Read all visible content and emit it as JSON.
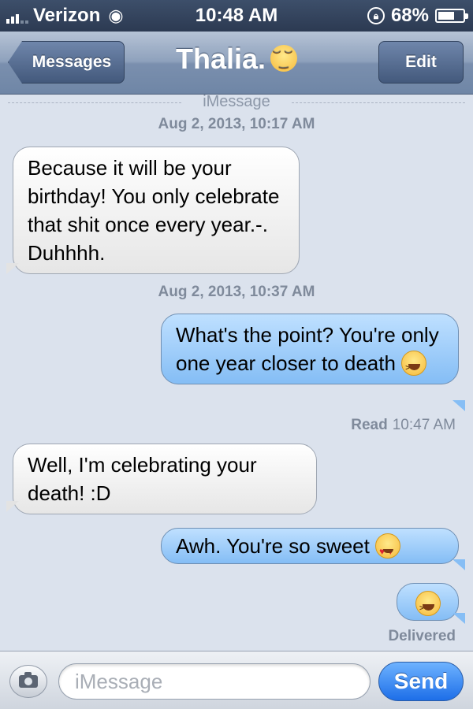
{
  "status_bar": {
    "carrier": "Verizon",
    "time": "10:48 AM",
    "battery": "68%",
    "battery_level": 0.68
  },
  "nav": {
    "back_label": "Messages",
    "title": "Thalia.",
    "edit_label": "Edit"
  },
  "conversation": {
    "service_label": "iMessage",
    "timestamp_1": "Aug 2, 2013, 10:17 AM",
    "timestamp_2": "Aug 2, 2013, 10:37 AM",
    "messages": [
      {
        "direction": "incoming",
        "text": "Because it will be your birthday! You only celebrate that shit once every year.-. Duhhhh."
      },
      {
        "direction": "outgoing",
        "text": "What's the point? You're only one year closer to death",
        "emoji": "laughing-tears-icon"
      },
      {
        "direction": "incoming",
        "text": "Well, I'm celebrating your death! :D"
      },
      {
        "direction": "outgoing",
        "text": "Awh. You're so sweet",
        "emoji": "heart-eyes-icon"
      },
      {
        "direction": "outgoing",
        "text": "",
        "emoji": "laughing-tears-icon"
      }
    ],
    "read_receipt": {
      "label": "Read",
      "time": "10:47 AM"
    },
    "delivered_label": "Delivered"
  },
  "input_bar": {
    "placeholder": "iMessage",
    "send_label": "Send"
  },
  "colors": {
    "background": "#dbe2ed",
    "outgoing_bubble": "#84bdf5",
    "incoming_bubble": "#ffffff",
    "send_button": "#1d6ee8"
  }
}
